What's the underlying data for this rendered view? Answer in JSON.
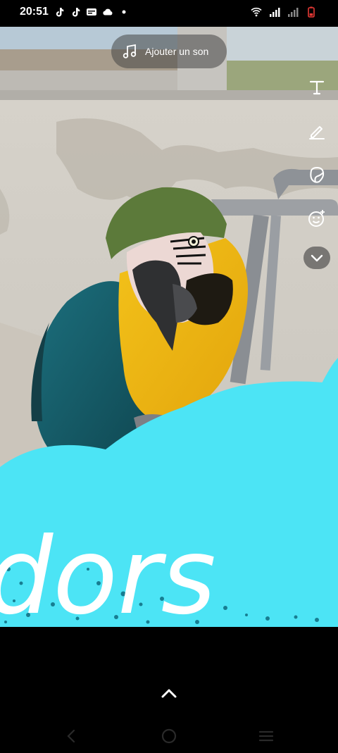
{
  "status_bar": {
    "time": "20:51",
    "left_icons": [
      "tiktok-icon",
      "tiktok-icon",
      "notification-icon",
      "cloud-icon",
      "dot-icon"
    ],
    "right_icons": [
      "wifi-icon",
      "signal-icon",
      "signal-icon",
      "battery-icon"
    ],
    "battery_color": "#e53935"
  },
  "editor": {
    "add_sound_label": "Ajouter un son",
    "tools": [
      "text-icon",
      "pencil-icon",
      "sticker-icon",
      "emoji-icon",
      "chevron-down-icon"
    ],
    "overlay_text": "dors",
    "overlay_color": "#4ce4f5"
  },
  "bottom": {
    "expand_icon": "chevron-up-icon",
    "nav": [
      "back-icon",
      "home-icon",
      "recents-icon"
    ]
  }
}
